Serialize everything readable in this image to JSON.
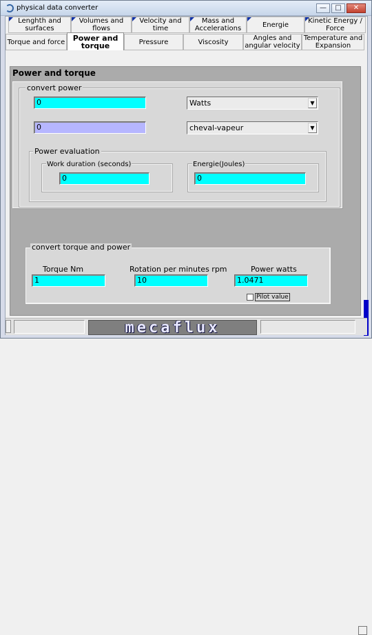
{
  "window": {
    "title": "physical data converter",
    "minimize_label": "—",
    "maximize_label": "□",
    "close_label": "✕"
  },
  "tabs_row1": [
    {
      "label": "Lenghth and surfaces"
    },
    {
      "label": "Volumes and flows"
    },
    {
      "label": "Velocity and time"
    },
    {
      "label": "Mass and Accelerations"
    },
    {
      "label": "Energie"
    },
    {
      "label": "Kinetic Energy / Force"
    }
  ],
  "tabs_row2": [
    {
      "label": "Torque and force"
    },
    {
      "label": "Power and torque"
    },
    {
      "label": "Pressure"
    },
    {
      "label": "Viscosity"
    },
    {
      "label": "Angles and angular velocity"
    },
    {
      "label": "Temperature and Expansion"
    }
  ],
  "content": {
    "title": "Power and torque",
    "convert_power": {
      "label": "convert power",
      "input1_value": "0",
      "unit1": "Watts",
      "input2_value": "0",
      "unit2": "cheval-vapeur",
      "power_evaluation": {
        "label": "Power evaluation",
        "work_duration_label": "Work duration (seconds)",
        "work_duration_value": "0",
        "energie_label": "Energie(Joules)",
        "energie_value": "0"
      }
    },
    "convert_torque": {
      "label": "convert torque and power",
      "torque_label": "Torque  Nm",
      "torque_value": "1",
      "rotation_label": "Rotation per minutes rpm",
      "rotation_value": "10",
      "power_label": "Power  watts",
      "power_value": "1.0471",
      "pilot_label": "Pilot value"
    }
  },
  "statusbar": {
    "logo_text": "mecaflux"
  }
}
